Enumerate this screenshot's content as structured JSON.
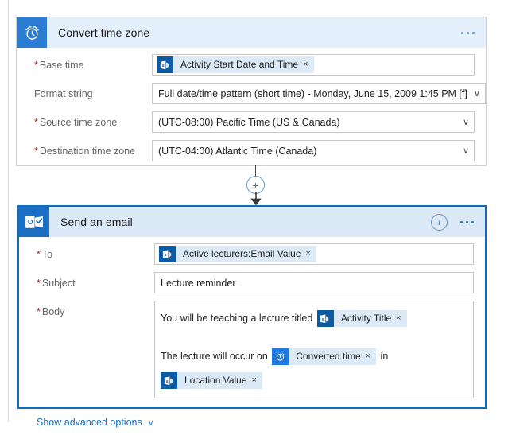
{
  "cards": [
    {
      "id": "convert-time-zone",
      "icon": "alarm-clock-icon",
      "title": "Convert time zone",
      "selected": false,
      "has_info": false,
      "rows": [
        {
          "label": "Base time",
          "required": true,
          "type": "token",
          "tokens": [
            {
              "icon": "sharepoint-icon",
              "label": "Activity Start Date and Time",
              "remove": "×"
            }
          ]
        },
        {
          "label": "Format string",
          "required": false,
          "type": "dropdown",
          "value": "Full date/time pattern (short time) - Monday, June 15, 2009 1:45 PM [f]",
          "chevron": "∨"
        },
        {
          "label": "Source time zone",
          "required": true,
          "type": "dropdown",
          "value": "(UTC-08:00) Pacific Time (US & Canada)",
          "chevron": "∨"
        },
        {
          "label": "Destination time zone",
          "required": true,
          "type": "dropdown",
          "value": "(UTC-04:00) Atlantic Time (Canada)",
          "chevron": "∨"
        }
      ]
    },
    {
      "id": "send-an-email",
      "icon": "outlook-icon",
      "title": "Send an email",
      "selected": true,
      "has_info": true,
      "info_glyph": "i",
      "rows": [
        {
          "label": "To",
          "required": true,
          "type": "token",
          "tokens": [
            {
              "icon": "sharepoint-icon",
              "label": "Active lecturers:Email Value",
              "remove": "×"
            }
          ]
        },
        {
          "label": "Subject",
          "required": true,
          "type": "text",
          "value": "Lecture reminder"
        },
        {
          "label": "Body",
          "required": true,
          "type": "richtext"
        }
      ]
    }
  ],
  "body_field": {
    "line1_prefix": "You will be teaching a lecture titled ",
    "line1_token": {
      "icon": "sharepoint-icon",
      "label": "Activity Title",
      "remove": "×"
    },
    "line2_prefix": "The lecture will occur on ",
    "line2_token": {
      "icon": "alarm-clock-icon",
      "label": "Converted time",
      "remove": "×"
    },
    "line2_middle": " in",
    "line3_token": {
      "icon": "sharepoint-icon",
      "label": "Location Value",
      "remove": "×"
    }
  },
  "advanced_options": {
    "label": "Show advanced options",
    "chevron": "∨"
  },
  "connector": {
    "add_label": "+",
    "name": "insert-new-step"
  },
  "colors": {
    "accent": "#0f6cbd",
    "header_band": "#e3effb",
    "app_icon": "#2b7cd3",
    "token_bg": "#dceaf7",
    "token_icon": "#0b5ca5",
    "required_asterisk": "#a4262c",
    "link": "#1a6fb5",
    "field_border": "#c8c8c8"
  }
}
